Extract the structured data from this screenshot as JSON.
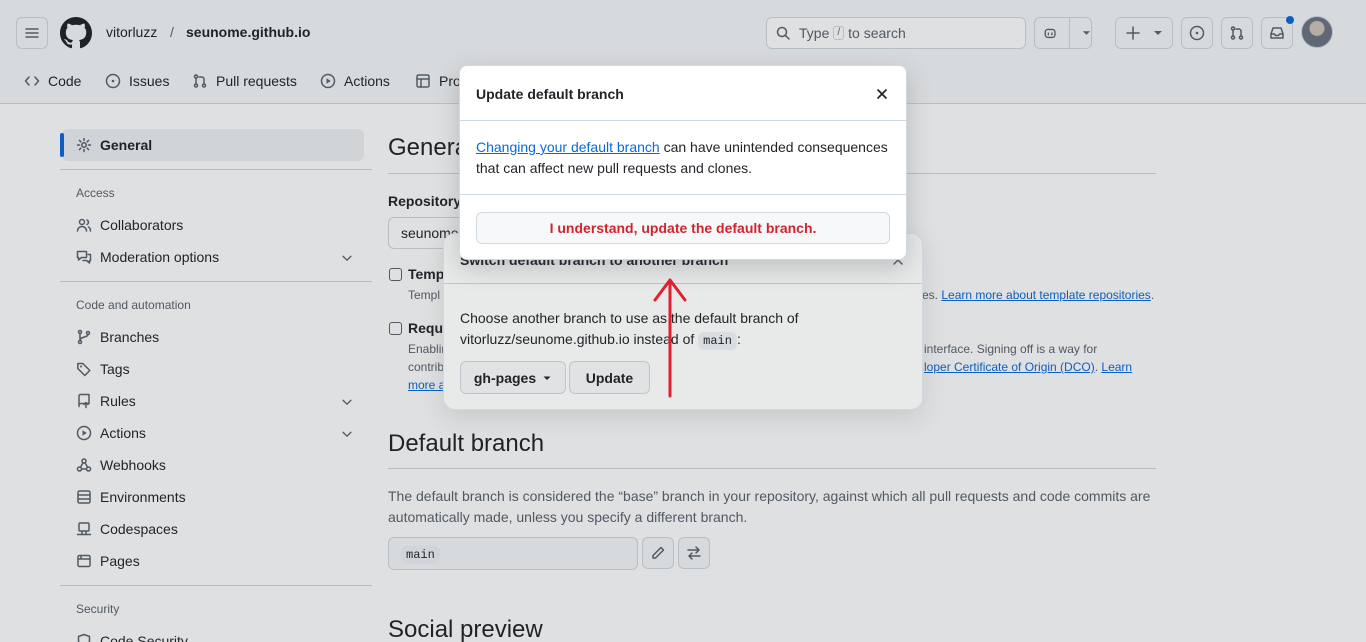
{
  "header": {
    "owner": "vitorluzz",
    "separator": "/",
    "repo": "seunome.github.io",
    "search_prefix": "Type",
    "search_key": "/",
    "search_suffix": "to search"
  },
  "tabs": [
    {
      "label": "Code"
    },
    {
      "label": "Issues"
    },
    {
      "label": "Pull requests"
    },
    {
      "label": "Actions"
    },
    {
      "label": "Pro"
    }
  ],
  "sidebar": {
    "general": "General",
    "access_heading": "Access",
    "collaborators": "Collaborators",
    "moderation": "Moderation options",
    "code_heading": "Code and automation",
    "branches": "Branches",
    "tags": "Tags",
    "rules": "Rules",
    "actions": "Actions",
    "webhooks": "Webhooks",
    "environments": "Environments",
    "codespaces": "Codespaces",
    "pages": "Pages",
    "security_heading": "Security",
    "code_security": "Code Security"
  },
  "main": {
    "title": "Genera",
    "repo_label": "Repository",
    "repo_value": "seunome",
    "template_label": "Temp",
    "template_desc": "Templ",
    "template_desc_tail": "es.",
    "template_link": "Learn more about template repositories",
    "template_link_end": ".",
    "require_label": "Requi",
    "require_desc1": "Enablin",
    "require_desc1_tail": "interface. Signing off is a way for",
    "require_desc2": "contrib",
    "require_desc2_link": "loper Certificate of Origin (DCO)",
    "require_desc2_mid": ".",
    "require_desc2_link2": "Learn",
    "require_desc3_link": "more a",
    "default_branch_title": "Default branch",
    "default_branch_desc": "The default branch is considered the “base” branch in your repository, against which all pull requests and code commits are automatically made, unless you specify a different branch.",
    "default_branch_value": "main",
    "social_title": "Social preview"
  },
  "switch_dialog": {
    "title": "Switch default branch to another branch",
    "desc_line1": "Choose another branch to use as the default branch of",
    "desc_line2": "vitorluzz/seunome.github.io instead of",
    "desc_code": "main",
    "desc_end": ":",
    "branch_select": "gh-pages",
    "update_button": "Update"
  },
  "update_dialog": {
    "title": "Update default branch",
    "link_text": "Changing your default branch",
    "body_rest": " can have unintended consequences that can affect new pull requests and clones.",
    "confirm_button": "I understand, update the default branch."
  },
  "colors": {
    "accent": "#0969da",
    "danger": "#d1242f",
    "annotation_arrow": "#e0202e"
  }
}
